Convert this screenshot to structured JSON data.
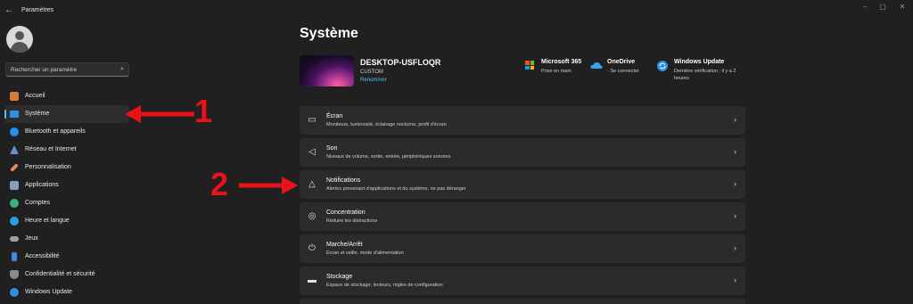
{
  "window": {
    "title": "Paramètres",
    "controls": [
      "–",
      "▢",
      "✕"
    ]
  },
  "search": {
    "placeholder": "Rechercher un paramètre"
  },
  "sidebar": {
    "items": [
      {
        "label": "Accueil",
        "icon": "home-icon",
        "color": "#d87a3a"
      },
      {
        "label": "Système",
        "icon": "system-icon",
        "color": "#2d8fe0",
        "selected": true
      },
      {
        "label": "Bluetooth et appareils",
        "icon": "bluetooth-icon",
        "color": "#1f8ff0"
      },
      {
        "label": "Réseau et Internet",
        "icon": "network-icon",
        "color": "#6b8ec9"
      },
      {
        "label": "Personnalisation",
        "icon": "brush-icon",
        "color": "#e08a5a"
      },
      {
        "label": "Applications",
        "icon": "apps-icon",
        "color": "#8aa0c0"
      },
      {
        "label": "Comptes",
        "icon": "accounts-icon",
        "color": "#3fb07a"
      },
      {
        "label": "Heure et langue",
        "icon": "globe-icon",
        "color": "#2f9fd8"
      },
      {
        "label": "Jeux",
        "icon": "gamepad-icon",
        "color": "#a0a0a0"
      },
      {
        "label": "Accessibilité",
        "icon": "accessibility-icon",
        "color": "#3a8fd8"
      },
      {
        "label": "Confidentialité et sécurité",
        "icon": "shield-icon",
        "color": "#8a8a8a"
      },
      {
        "label": "Windows Update",
        "icon": "update-icon",
        "color": "#2f8fe0"
      }
    ]
  },
  "annotations": {
    "step1": "1",
    "step2": "2",
    "arrow_color": "#e8121b"
  },
  "main": {
    "title": "Système",
    "device": {
      "name": "DESKTOP-USFLOQR",
      "subtitle": "CUSTOM",
      "rename": "Renommer"
    },
    "services": [
      {
        "title": "Microsoft 365",
        "subtitle": "Prise en main",
        "icon": "microsoft-logo-icon"
      },
      {
        "title": "OneDrive",
        "subtitle": "· Se connecter",
        "icon": "onedrive-icon"
      },
      {
        "title": "Windows Update",
        "subtitle": "Dernière vérification : il y a 2 heures",
        "icon": "update-icon"
      }
    ],
    "cards": [
      {
        "title": "Écran",
        "subtitle": "Moniteurs, luminosité, éclairage nocturne, profil d'écran",
        "icon": "display-icon"
      },
      {
        "title": "Son",
        "subtitle": "Niveaux de volume, sortie, entrée, périphériques sonores",
        "icon": "speaker-icon"
      },
      {
        "title": "Notifications",
        "subtitle": "Alertes provenant d'applications et du système, ne pas déranger",
        "icon": "bell-icon"
      },
      {
        "title": "Concentration",
        "subtitle": "Réduire les distractions",
        "icon": "focus-icon"
      },
      {
        "title": "Marche/Arrêt",
        "subtitle": "Écran et veille, mode d'alimentation",
        "icon": "power-icon"
      },
      {
        "title": "Stockage",
        "subtitle": "Espace de stockage, lecteurs, règles de configuration",
        "icon": "storage-icon"
      }
    ]
  }
}
